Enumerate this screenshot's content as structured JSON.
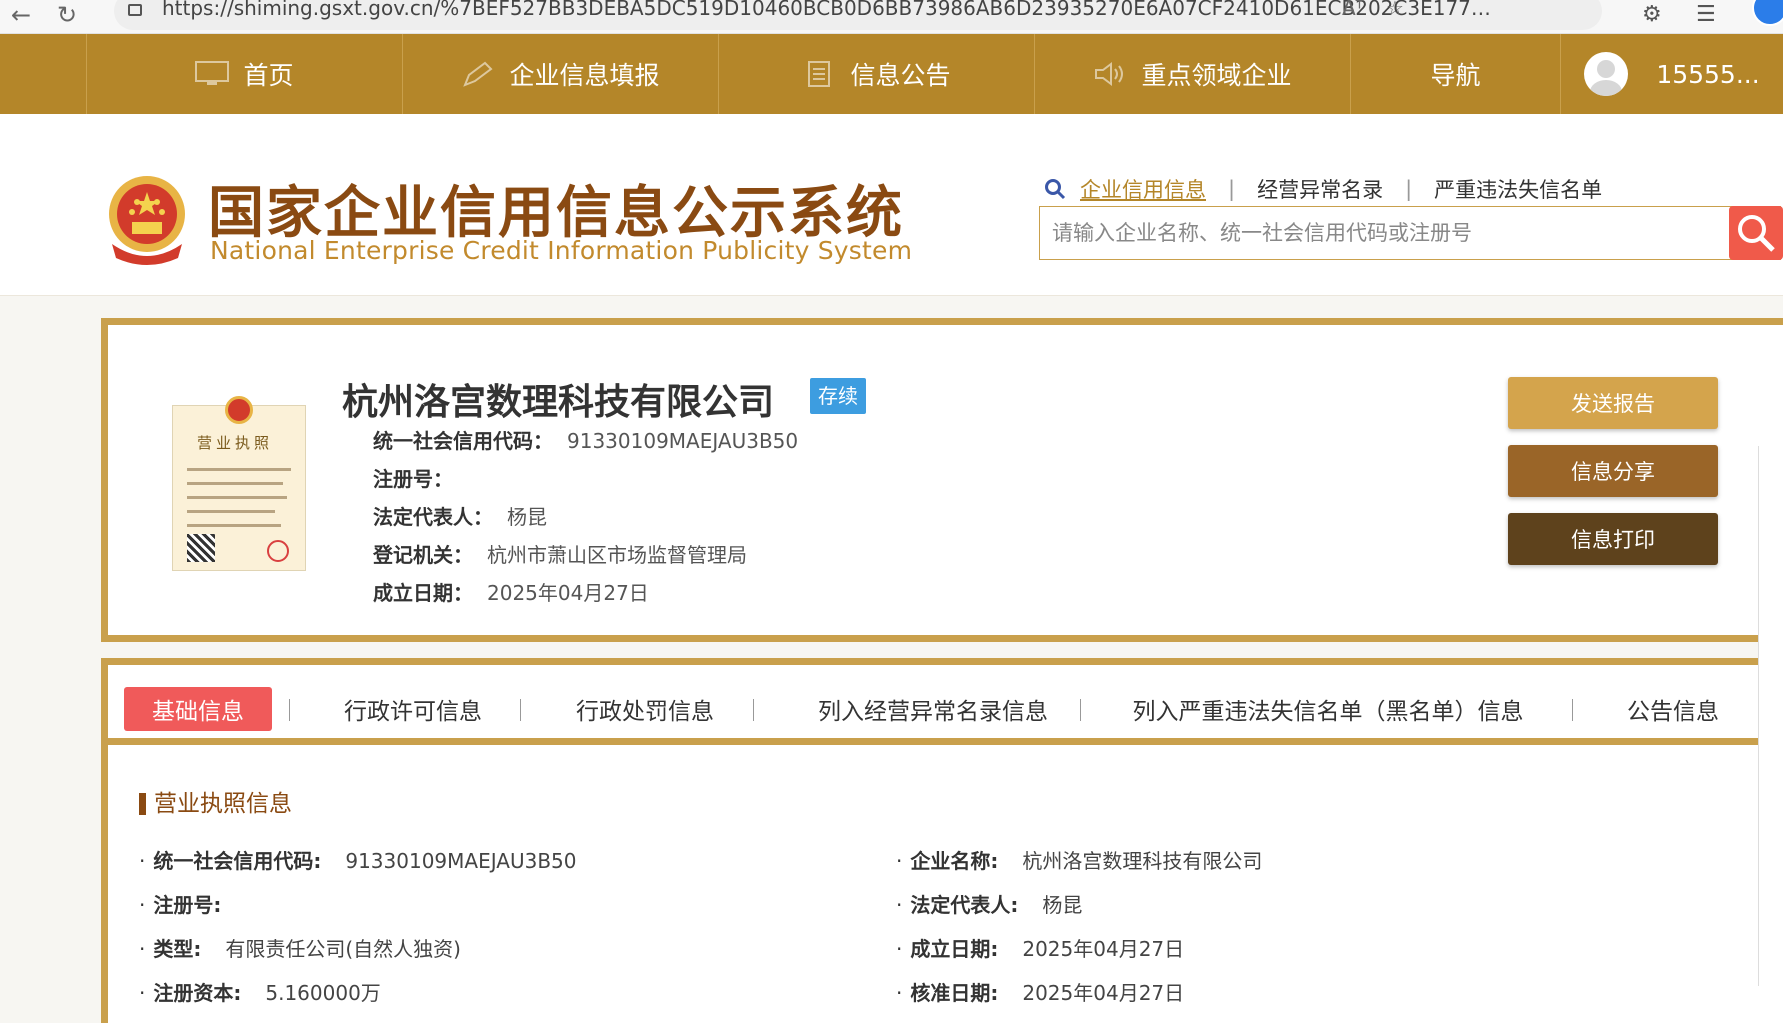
{
  "browser": {
    "url": "https://shiming.gsxt.gov.cn/%7BEF527BB3DEBA5DC519D10460BCB0D6BB73986AB6D23935270E6A07CF2410D61ECB202C3E17738119016CF4EC...",
    "read_aloud": "Aᵀ",
    "icons": [
      "back-icon",
      "refresh-icon",
      "site-info-icon",
      "favorite-star-icon",
      "extensions-icon",
      "collections-icon",
      "profile-avatar"
    ]
  },
  "nav": {
    "items": [
      {
        "label": "首页",
        "icon": "monitor-icon"
      },
      {
        "label": "企业信息填报",
        "icon": "pen-icon"
      },
      {
        "label": "信息公告",
        "icon": "document-icon"
      },
      {
        "label": "重点领域企业",
        "icon": "speaker-icon"
      },
      {
        "label": "导航",
        "icon": ""
      }
    ],
    "user": "15555..."
  },
  "header": {
    "logo_cn": "国家企业信用信息公示系统",
    "logo_en": "National Enterprise Credit Information Publicity System",
    "search_tabs": [
      "企业信用信息",
      "经营异常名录",
      "严重违法失信名单"
    ],
    "search_placeholder": "请输入企业名称、统一社会信用代码或注册号"
  },
  "company": {
    "name": "杭州洛宫数理科技有限公司",
    "status": "存续",
    "license_title": "营业执照",
    "fields": [
      {
        "label": "统一社会信用代码：",
        "value": "91330109MAEJAU3B50"
      },
      {
        "label": "注册号：",
        "value": ""
      },
      {
        "label": "法定代表人：",
        "value": "杨昆"
      },
      {
        "label": "登记机关：",
        "value": "杭州市萧山区市场监督管理局"
      },
      {
        "label": "成立日期：",
        "value": "2025年04月27日"
      }
    ],
    "actions": [
      "发送报告",
      "信息分享",
      "信息打印"
    ]
  },
  "tabs": {
    "items": [
      "基础信息",
      "行政许可信息",
      "行政处罚信息",
      "列入经营异常名录信息",
      "列入严重违法失信名单（黑名单）信息",
      "公告信息"
    ],
    "active_index": 0
  },
  "license_info": {
    "title": "营业执照信息",
    "left": [
      {
        "label": "统一社会信用代码:",
        "value": "91330109MAEJAU3B50"
      },
      {
        "label": "注册号:",
        "value": ""
      },
      {
        "label": "类型:",
        "value": "有限责任公司(自然人独资)"
      },
      {
        "label": "注册资本:",
        "value": "5.160000万"
      }
    ],
    "right": [
      {
        "label": "企业名称:",
        "value": "杭州洛宫数理科技有限公司"
      },
      {
        "label": "法定代表人:",
        "value": "杨昆"
      },
      {
        "label": "成立日期:",
        "value": "2025年04月27日"
      },
      {
        "label": "核准日期:",
        "value": "2025年04月27日"
      }
    ]
  },
  "colors": {
    "nav_bg": "#b48629",
    "brand_brown": "#8a4a12",
    "gold_border": "#c9a04c",
    "active_tab": "#f05a5a",
    "status_badge": "#3d9de0",
    "btn_send": "#d4a44c",
    "btn_share": "#9a6528",
    "btn_print": "#5e421c"
  }
}
